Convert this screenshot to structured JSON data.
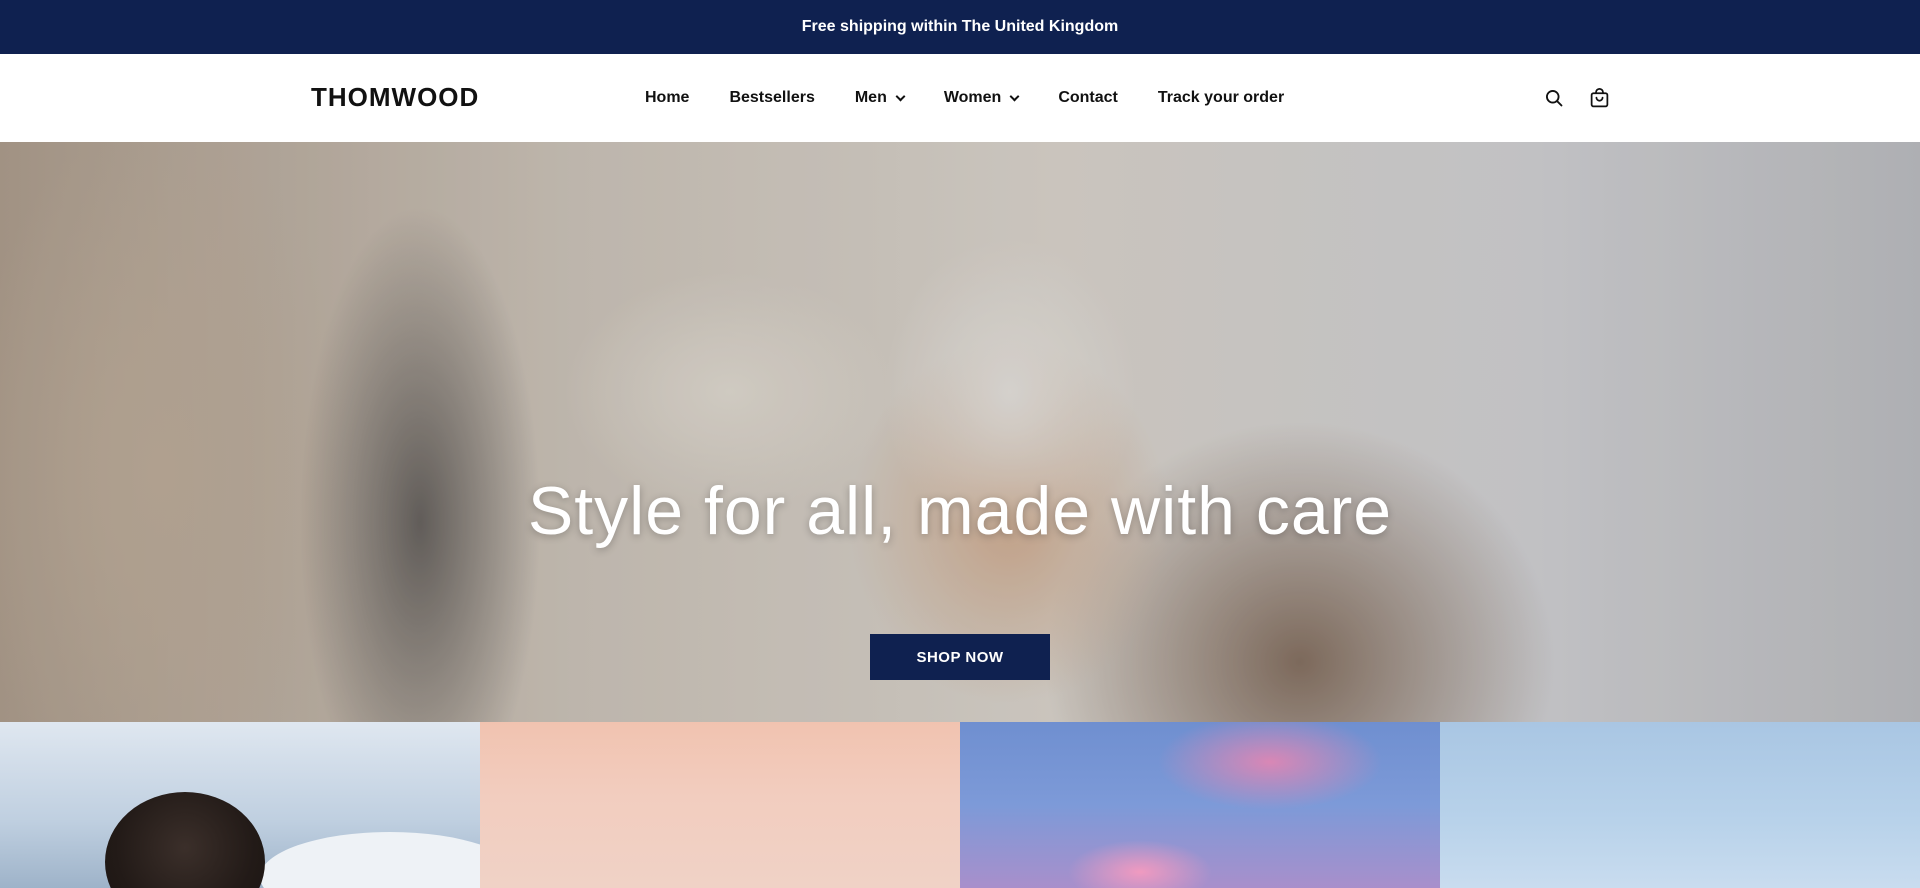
{
  "announcement": {
    "text": "Free shipping within The United Kingdom"
  },
  "header": {
    "logo": "THOMWOOD",
    "nav": [
      {
        "label": "Home",
        "has_dropdown": false
      },
      {
        "label": "Bestsellers",
        "has_dropdown": false
      },
      {
        "label": "Men",
        "has_dropdown": true
      },
      {
        "label": "Women",
        "has_dropdown": true
      },
      {
        "label": "Contact",
        "has_dropdown": false
      },
      {
        "label": "Track your order",
        "has_dropdown": false
      }
    ],
    "icons": [
      "search-icon",
      "cart-icon"
    ]
  },
  "hero": {
    "title": "Style for all, made with care",
    "button_label": "SHOP NOW"
  },
  "colors": {
    "navy": "#0f2150",
    "white": "#ffffff",
    "text": "#111111"
  }
}
